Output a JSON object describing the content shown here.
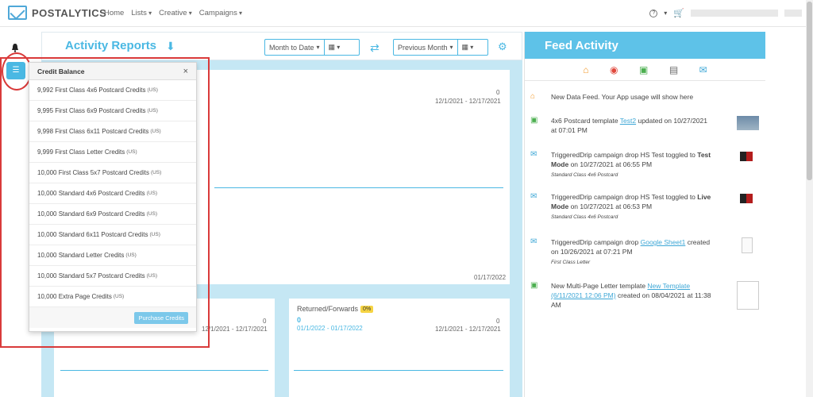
{
  "topnav": {
    "brand": "POSTALYTICS",
    "menu": [
      {
        "label": "Home"
      },
      {
        "label": "Lists"
      },
      {
        "label": "Creative"
      },
      {
        "label": "Campaigns"
      }
    ],
    "help_icon": "?"
  },
  "header": {
    "title": "Activity Reports",
    "range_select": "Month to Date",
    "compare_select": "Previous Month"
  },
  "cards": {
    "top": {
      "count": "0",
      "range": "12/1/2021 - 12/17/2021",
      "end_date": "01/17/2022"
    },
    "bottom_left": {
      "count": "0",
      "range": "12/1/2021 - 12/17/2021"
    },
    "bottom_right": {
      "title": "Returned/Forwards",
      "badge": "0%",
      "primary_count": "0",
      "primary_range": "01/1/2022 - 01/17/2022",
      "count": "0",
      "range": "12/1/2021 - 12/17/2021"
    }
  },
  "credit_popup": {
    "title": "Credit Balance",
    "close": "×",
    "credits": [
      {
        "label": "9,992 First Class 4x6 Postcard Credits",
        "region": "(US)"
      },
      {
        "label": "9,995 First Class 6x9 Postcard Credits",
        "region": "(US)"
      },
      {
        "label": "9,998 First Class 6x11 Postcard Credits",
        "region": "(US)"
      },
      {
        "label": "9,999 First Class Letter Credits",
        "region": "(US)"
      },
      {
        "label": "10,000 First Class 5x7 Postcard Credits",
        "region": "(US)"
      },
      {
        "label": "10,000 Standard 4x6 Postcard Credits",
        "region": "(US)"
      },
      {
        "label": "10,000 Standard 6x9 Postcard Credits",
        "region": "(US)"
      },
      {
        "label": "10,000 Standard 6x11 Postcard Credits",
        "region": "(US)"
      },
      {
        "label": "10,000 Standard Letter Credits",
        "region": "(US)"
      },
      {
        "label": "10,000 Standard 5x7 Postcard Credits",
        "region": "(US)"
      },
      {
        "label": "10,000 Extra Page Credits",
        "region": "(US)"
      }
    ],
    "purchase_label": "Purchase Credits"
  },
  "feed": {
    "title": "Feed Activity",
    "items": [
      {
        "icon": "home-icon",
        "text": "New Data Feed. Your App usage will show here"
      },
      {
        "icon": "image-icon",
        "pre": "4x6 Postcard template ",
        "link": "Test2",
        "post": " updated on 10/27/2021 at 07:01 PM"
      },
      {
        "icon": "envelope-icon",
        "pre": "TriggeredDrip campaign drop HS Test toggled to ",
        "strong": "Test Mode",
        "post": " on 10/27/2021 at 06:55 PM",
        "sub": "Standard Class 4x6 Postcard"
      },
      {
        "icon": "envelope-icon",
        "pre": "TriggeredDrip campaign drop HS Test toggled to ",
        "strong": "Live Mode",
        "post": " on 10/27/2021 at 06:53 PM",
        "sub": "Standard Class 4x6 Postcard"
      },
      {
        "icon": "envelope-icon",
        "pre": "TriggeredDrip campaign drop ",
        "link": "Google Sheet1",
        "post": " created on 10/26/2021 at 07:21 PM",
        "sub": "First Class Letter"
      },
      {
        "icon": "image-icon",
        "pre": "New Multi-Page Letter template ",
        "link": "New Template (6/11/2021 12:06 PM)",
        "post": " created on 08/04/2021 at 11:38 AM"
      }
    ]
  },
  "colors": {
    "accent": "#4ab8e3",
    "highlight": "#d93a3a",
    "badge": "#f6d443"
  }
}
